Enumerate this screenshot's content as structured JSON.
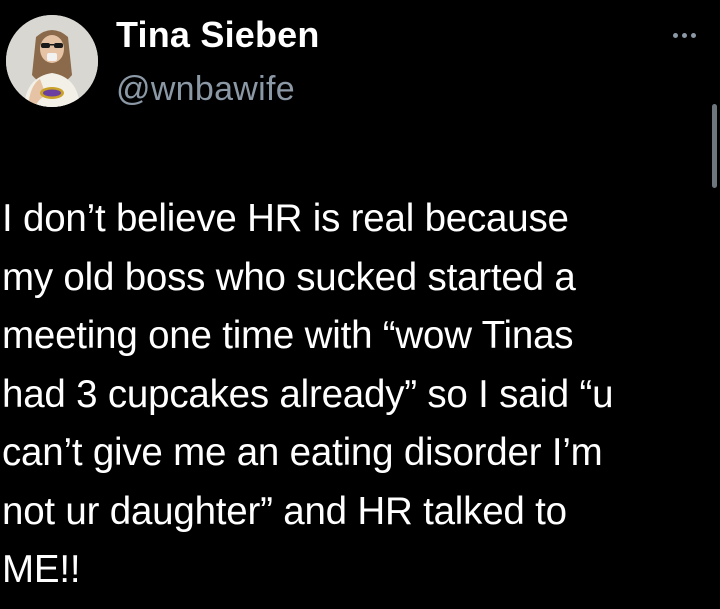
{
  "author": {
    "display_name": "Tina Sieben",
    "handle": "@wnbawife"
  },
  "tweet": {
    "text": "I don’t believe HR is real because\nmy old boss who sucked started a\nmeeting one time with “wow Tinas\nhad 3 cupcakes already” so I said “u\ncan’t give me an eating disorder I’m\nnot ur daughter” and HR talked to\nME!!"
  },
  "icons": {
    "more": "more-options-icon",
    "avatar": "profile-avatar"
  },
  "colors": {
    "background": "#000000",
    "text_primary": "#ffffff",
    "text_secondary": "#8b98a5"
  }
}
